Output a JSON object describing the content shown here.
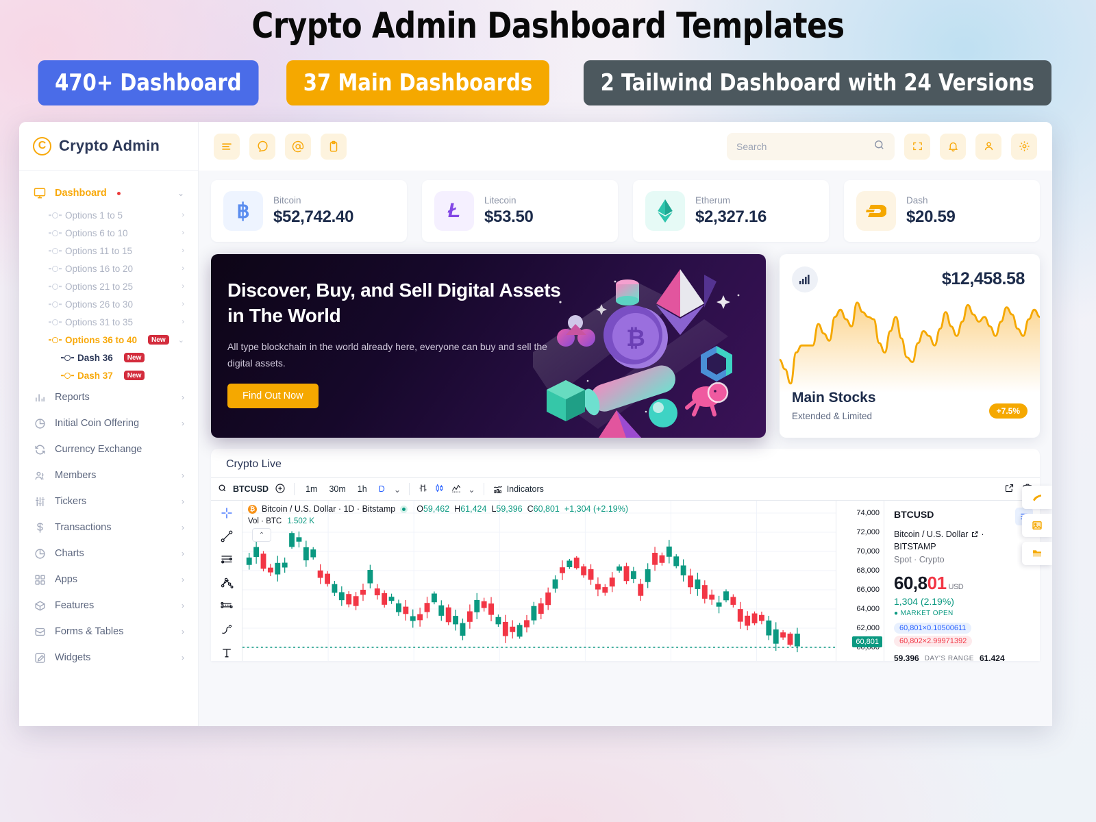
{
  "promo": {
    "title": "Crypto Admin Dashboard Templates",
    "pills": [
      {
        "label": "470+ Dashboard",
        "color": "#4a6ce8"
      },
      {
        "label": "37 Main Dashboards",
        "color": "#f5a800"
      },
      {
        "label": "2 Tailwind Dashboard with 24 Versions",
        "color": "#4c585e"
      }
    ]
  },
  "sidebar": {
    "brand": "Crypto Admin",
    "dashboard": {
      "label": "Dashboard",
      "has_dot": true
    },
    "options": [
      {
        "label": "Options 1 to 5"
      },
      {
        "label": "Options 6 to 10"
      },
      {
        "label": "Options 11 to 15"
      },
      {
        "label": "Options 16 to 20"
      },
      {
        "label": "Options 21 to 25"
      },
      {
        "label": "Options 26 to 30"
      },
      {
        "label": "Options 31 to 35"
      },
      {
        "label": "Options 36 to 40",
        "badge": "New",
        "active": true
      }
    ],
    "dashes": [
      {
        "label": "Dash 36",
        "badge": "New"
      },
      {
        "label": "Dash 37",
        "badge": "New"
      }
    ],
    "items": [
      {
        "label": "Reports",
        "icon": "bar-chart-icon"
      },
      {
        "label": "Initial Coin Offering",
        "icon": "pie-chart-icon"
      },
      {
        "label": "Currency Exchange",
        "icon": "refresh-icon",
        "no_chevron": true
      },
      {
        "label": "Members",
        "icon": "users-icon"
      },
      {
        "label": "Tickers",
        "icon": "sliders-icon"
      },
      {
        "label": "Transactions",
        "icon": "dollar-icon"
      },
      {
        "label": "Charts",
        "icon": "pie-chart-icon"
      },
      {
        "label": "Apps",
        "icon": "grid-icon"
      },
      {
        "label": "Features",
        "icon": "box-icon"
      },
      {
        "label": "Forms & Tables",
        "icon": "inbox-icon"
      },
      {
        "label": "Widgets",
        "icon": "edit-icon"
      }
    ]
  },
  "topbar": {
    "left_icons": [
      "menu-icon",
      "chat-icon",
      "mention-icon",
      "clipboard-icon"
    ],
    "right_icons": [
      "fullscreen-icon",
      "bell-icon",
      "user-icon",
      "gear-icon"
    ],
    "search_placeholder": "Search",
    "search_value": ""
  },
  "coins": [
    {
      "name": "Bitcoin",
      "price": "$52,742.40",
      "symbol": "Ƀ",
      "color": "#5b8def",
      "bg": "#eef4ff"
    },
    {
      "name": "Litecoin",
      "price": "$53.50",
      "symbol": "Ł",
      "color": "#8247e5",
      "bg": "#f5f0ff"
    },
    {
      "name": "Etherum",
      "price": "$2,327.16",
      "symbol": "⧓",
      "color": "#2ec5ad",
      "bg": "#e6faf6"
    },
    {
      "name": "Dash",
      "price": "$20.59",
      "symbol": "D",
      "color": "#f5a800",
      "bg": "#fdf4e3"
    }
  ],
  "hero": {
    "title": "Discover, Buy, and Sell Digital Assets in The World",
    "body": "All type blockchain in the world already here, everyone can buy and sell the digital assets.",
    "cta": "Find Out Now"
  },
  "stocks": {
    "value": "$12,458.58",
    "title": "Main Stocks",
    "subtitle": "Extended & Limited",
    "change": "+7.5%",
    "accent": "#f5a800"
  },
  "live": {
    "heading": "Crypto Live",
    "toolbar": {
      "symbol": "BTCUSD",
      "timeframes": [
        "1m",
        "30m",
        "1h",
        "D"
      ],
      "selected_timeframe": "D",
      "indicators_label": "Indicators"
    },
    "legend": {
      "title": "Bitcoin / U.S. Dollar · 1D · Bitstamp",
      "open_label": "O",
      "open": "59,462",
      "high_label": "H",
      "high": "61,424",
      "low_label": "L",
      "low": "59,396",
      "close_label": "C",
      "close": "60,801",
      "change": "+1,304 (+2.19%)",
      "volume_label": "Vol · BTC",
      "volume": "1.502 K"
    },
    "axis_ticks": [
      "74,000",
      "72,000",
      "70,000",
      "68,000",
      "66,000",
      "64,000",
      "62,000",
      "60,000"
    ],
    "current_price_tag": "60,801",
    "panel": {
      "symbol": "BTCUSD",
      "desc": "Bitcoin / U.S. Dollar",
      "exchange": "BITSTAMP",
      "type": "Spot · Crypto",
      "price_main": "60,8",
      "price_accent": "01",
      "currency": "USD",
      "change": "1,304 (2.19%)",
      "status": "MARKET OPEN",
      "bid": "60,801×0.10500611",
      "ask": "60,802×2.99971392",
      "range_low": "59,396",
      "range_label": "DAY'S RANGE",
      "range_high": "61,424"
    }
  },
  "chart_data": {
    "type": "area",
    "title": "Main Stocks",
    "series": [
      {
        "name": "Main Stocks",
        "values": [
          38,
          30,
          18,
          44,
          50,
          50,
          50,
          68,
          60,
          54,
          74,
          80,
          72,
          66,
          86,
          78,
          74,
          72,
          52,
          44,
          62,
          74,
          56,
          40,
          36,
          52,
          62,
          58,
          50,
          64,
          78,
          66,
          58,
          70,
          84,
          76,
          70,
          74,
          66,
          58,
          70,
          82,
          76,
          64,
          58,
          72,
          80,
          74
        ]
      }
    ],
    "ylabel": "",
    "xlabel": "",
    "grid": false,
    "legend": "none"
  }
}
